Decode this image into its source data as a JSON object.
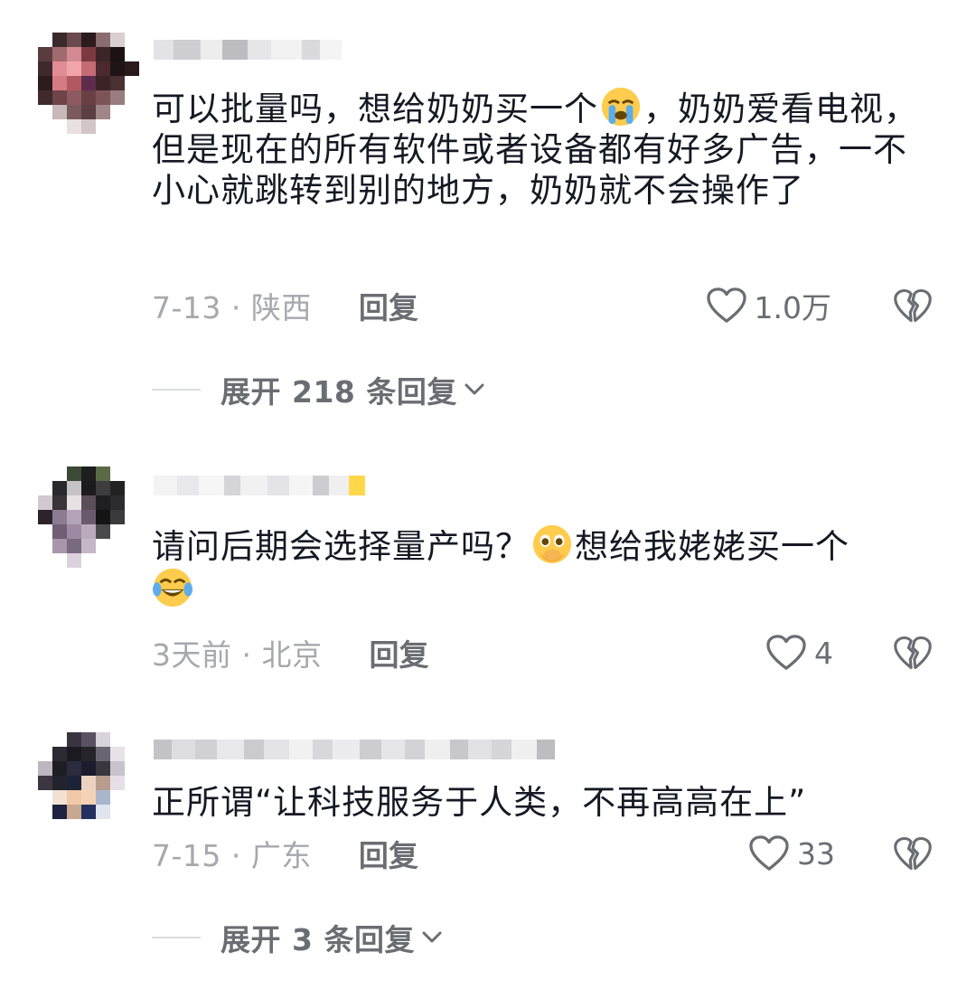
{
  "comments": [
    {
      "text_before": "可以批量吗，想给奶奶买一个",
      "emoji_1": "loudly-crying-face",
      "text_after": "，奶奶爱看电视，但是现在的所有软件或者设备都有好多广告，一不小心就跳转到别的地方，奶奶就不会操作了",
      "date_location": "7-13 · 陕西",
      "reply_label": "回复",
      "like_count": "1.0万",
      "expand_label": "展开 218 条回复"
    },
    {
      "text_before": "请问后期会选择量产吗？",
      "emoji_1": "face-holding-back-tears",
      "text_after": "想给我姥姥买一个",
      "emoji_2": "tears-of-joy-face",
      "date_location": "3天前 · 北京",
      "reply_label": "回复",
      "like_count": "4"
    },
    {
      "text_before": "正所谓“让科技服务于人类，不再高高在上”",
      "date_location": "7-15 · 广东",
      "reply_label": "回复",
      "like_count": "33",
      "expand_label": "展开 3 条回复"
    }
  ],
  "icons": {
    "like": "heart-outline-icon",
    "dislike": "broken-heart-icon",
    "expand": "chevron-down-icon"
  },
  "colors": {
    "text_primary": "#161823",
    "text_secondary": "#a7a8ad",
    "text_action": "#6b6d73"
  }
}
